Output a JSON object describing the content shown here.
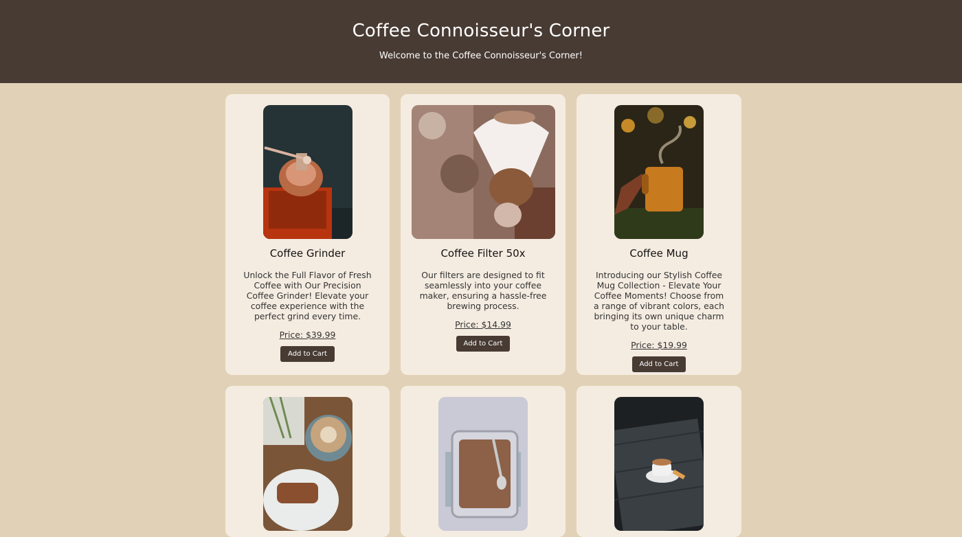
{
  "header": {
    "title": "Coffee Connoisseur's Corner",
    "subtitle": "Welcome to the Coffee Connoisseur's Corner!"
  },
  "products": [
    {
      "name": "Coffee Grinder",
      "description": "Unlock the Full Flavor of Fresh Coffee with Our Precision Coffee Grinder! Elevate your coffee experience with the perfect grind every time.",
      "price": "Price: $39.99",
      "button": "Add to Cart"
    },
    {
      "name": "Coffee Filter 50x",
      "description": "Our filters are designed to fit seamlessly into your coffee maker, ensuring a hassle-free brewing process.",
      "price": "Price: $14.99",
      "button": "Add to Cart"
    },
    {
      "name": "Coffee Mug",
      "description": "Introducing our Stylish Coffee Mug Collection - Elevate Your Coffee Moments! Choose from a range of vibrant colors, each bringing its own unique charm to your table.",
      "price": "Price: $19.99",
      "button": "Add to Cart"
    }
  ],
  "colors": {
    "header_bg": "#483b33",
    "page_bg": "#e1d1b6",
    "card_bg": "#f5ece1",
    "button_bg": "#483b33"
  }
}
